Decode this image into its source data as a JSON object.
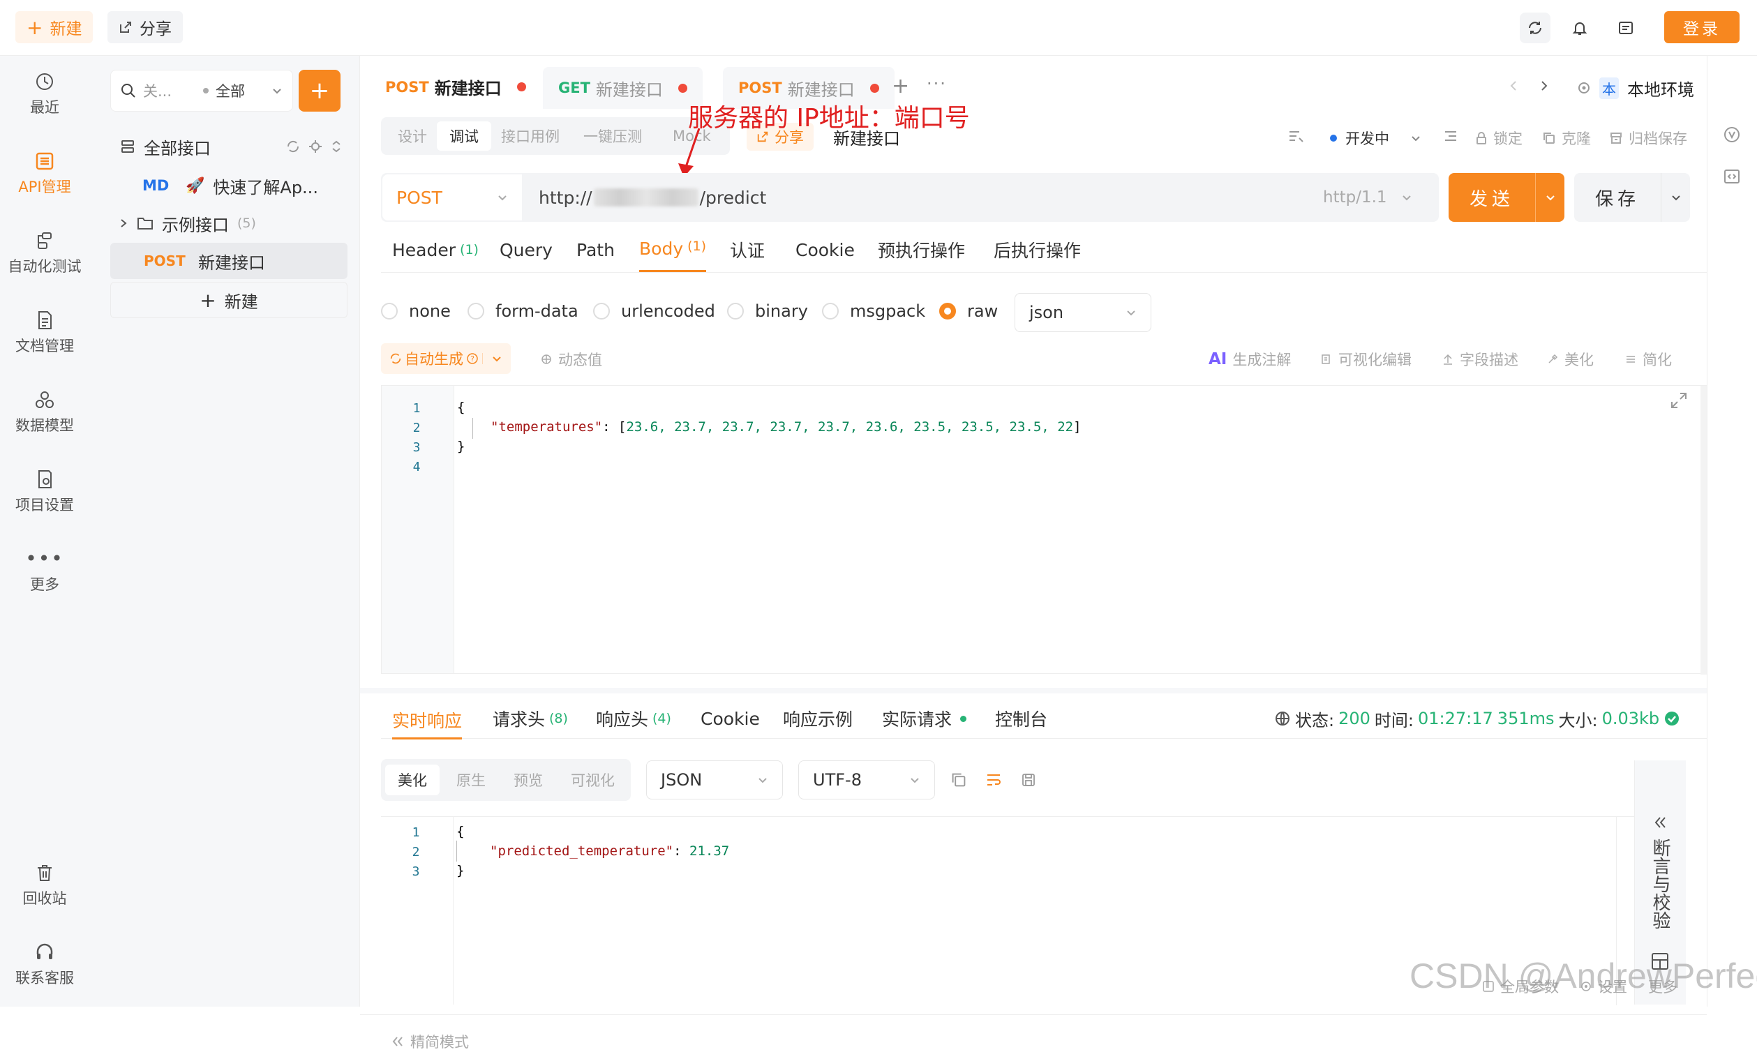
{
  "topbar": {
    "new_label": "新建",
    "share_label": "分享",
    "login_label": "登录"
  },
  "rail": {
    "items": [
      {
        "label": "最近",
        "icon": "history-icon"
      },
      {
        "label": "API管理",
        "icon": "api-icon"
      },
      {
        "label": "自动化测试",
        "icon": "automation-icon"
      },
      {
        "label": "文档管理",
        "icon": "document-icon"
      },
      {
        "label": "数据模型",
        "icon": "data-model-icon"
      },
      {
        "label": "项目设置",
        "icon": "settings-icon"
      },
      {
        "label": "更多",
        "icon": "more-icon"
      }
    ],
    "recycle_label": "回收站",
    "support_label": "联系客服"
  },
  "tree": {
    "search_placeholder": "关...",
    "filter_label": "全部",
    "all_label": "全部接口",
    "md_badge": "MD",
    "md_label": "快速了解Ap...",
    "folder_label": "示例接口",
    "folder_count": "(5)",
    "selected_method": "POST",
    "selected_label": "新建接口",
    "new_label": "新建"
  },
  "tabs": [
    {
      "method": "POST",
      "label": "新建接口"
    },
    {
      "method": "GET",
      "label": "新建接口"
    },
    {
      "method": "POST",
      "label": "新建接口"
    }
  ],
  "env": {
    "badge": "本",
    "label": "本地环境"
  },
  "subtabs": [
    "设计",
    "调试",
    "接口用例",
    "一键压测",
    "Mock"
  ],
  "share_inline": "分享",
  "endpoint_name": "新建接口",
  "annotation": "服务器的 IP地址：端口号",
  "status_label": "开发中",
  "actions": {
    "lock": "锁定",
    "clone": "克隆",
    "archive": "归档保存"
  },
  "request": {
    "method": "POST",
    "url_prefix": "http://",
    "url_suffix": "/predict",
    "protocol": "http/1.1",
    "send_label": "发送",
    "save_label": "保存"
  },
  "request_tabs": [
    {
      "label": "Header",
      "count": "(1)"
    },
    {
      "label": "Query",
      "count": ""
    },
    {
      "label": "Path",
      "count": ""
    },
    {
      "label": "Body",
      "count": "(1)"
    },
    {
      "label": "认证",
      "count": ""
    },
    {
      "label": "Cookie",
      "count": ""
    },
    {
      "label": "预执行操作",
      "count": ""
    },
    {
      "label": "后执行操作",
      "count": ""
    }
  ],
  "body_types": [
    "none",
    "form-data",
    "urlencoded",
    "binary",
    "msgpack",
    "raw"
  ],
  "body_format": "json",
  "body_tools": {
    "auto_gen": "自动生成",
    "dynamic": "动态值",
    "ai_gen": "生成注解",
    "visual_edit": "可视化编辑",
    "field_desc": "字段描述",
    "beautify": "美化",
    "simplify": "简化"
  },
  "request_code": {
    "line_numbers": [
      "1",
      "2",
      "3",
      "4"
    ],
    "open": "{",
    "key": "\"temperatures\"",
    "colon": ": [",
    "values": "23.6, 23.7, 23.7, 23.7, 23.7, 23.6, 23.5, 23.5, 23.5, 22",
    "end": "]",
    "close": "}"
  },
  "response_tabs": [
    {
      "label": "实时响应",
      "count": ""
    },
    {
      "label": "请求头",
      "count": "(8)"
    },
    {
      "label": "响应头",
      "count": "(4)"
    },
    {
      "label": "Cookie",
      "count": ""
    },
    {
      "label": "响应示例",
      "count": ""
    },
    {
      "label": "实际请求",
      "count": ""
    },
    {
      "label": "控制台",
      "count": ""
    }
  ],
  "response_status": {
    "status_label": "状态:",
    "status_value": "200",
    "time_label": "时间:",
    "time_value": "01:27:17",
    "duration": "351ms",
    "size_label": "大小:",
    "size_value": "0.03kb"
  },
  "view_tabs": [
    "美化",
    "原生",
    "预览",
    "可视化"
  ],
  "response_format": "JSON",
  "response_encoding": "UTF-8",
  "response_code": {
    "line_numbers": [
      "1",
      "2",
      "3"
    ],
    "open": "{",
    "key": "\"predicted_temperature\"",
    "colon": ": ",
    "value": "21.37",
    "close": "}"
  },
  "assert_panel": "断言与校验",
  "footer": {
    "simple_mode": "精简模式",
    "global_params": "全局参数",
    "settings": "设置",
    "more": "更多",
    "watermark": "CSDN @AndrewPerfect"
  },
  "colors": {
    "accent": "#f7871f",
    "success": "#27b375",
    "annotation": "#e02020"
  }
}
